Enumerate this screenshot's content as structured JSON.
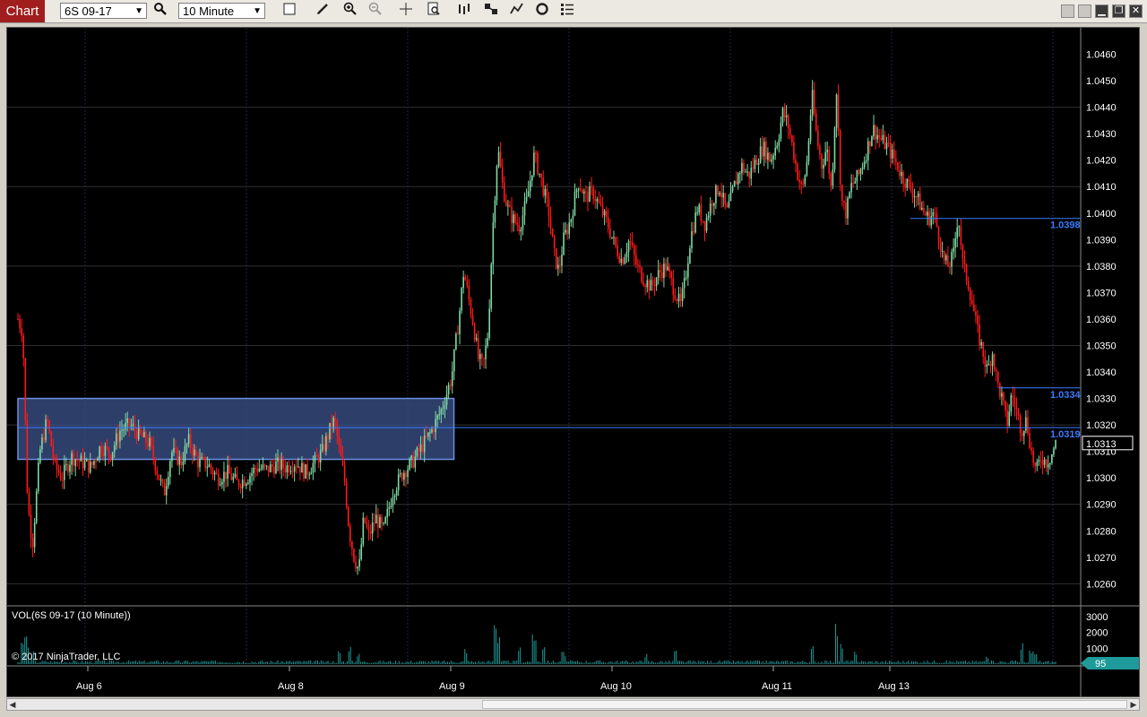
{
  "toolbar": {
    "title": "Chart",
    "instrument": "6S 09-17",
    "interval": "10 Minute"
  },
  "icons": [
    "magnifier-icon",
    "box-icon",
    "pencil-icon",
    "zoom-in-icon",
    "zoom-out-icon",
    "crosshair-icon",
    "properties-icon",
    "bars-icon",
    "tools-icon",
    "indicators-icon",
    "strategies-icon",
    "list-icon"
  ],
  "colors": {
    "up_candle": "#7fd9a3",
    "down_candle": "#ff1a1a",
    "grid": "#303030",
    "price_line": "#3a7bff",
    "rect_fill": "#3a4f86",
    "volume": "#1f9a9a"
  },
  "chart_data": {
    "type": "candlestick",
    "instrument": "6S 09-17",
    "interval": "10 Minute",
    "price_axis": [
      1.046,
      1.045,
      1.044,
      1.043,
      1.042,
      1.041,
      1.04,
      1.039,
      1.038,
      1.037,
      1.036,
      1.035,
      1.034,
      1.033,
      1.032,
      1.031,
      1.03,
      1.029,
      1.028,
      1.027,
      1.026
    ],
    "price_axis_labels": [
      "1.0460",
      "1.0450",
      "1.0440",
      "1.0430",
      "1.0420",
      "1.0410",
      "1.0400",
      "1.0390",
      "1.0380",
      "1.0370",
      "1.0360",
      "1.0350",
      "1.0340",
      "1.0330",
      "1.0320",
      "1.0310",
      "1.0300",
      "1.0290",
      "1.0280",
      "1.0270",
      "1.0260"
    ],
    "date_labels": [
      "Aug 6",
      "Aug 8",
      "Aug 9",
      "Aug 10",
      "Aug 11",
      "Aug 13"
    ],
    "current_price": 1.0313,
    "current_price_label": "1.0313",
    "horizontal_lines": [
      {
        "value": 1.0398,
        "label": "1.0398",
        "start_frac": 0.86
      },
      {
        "value": 1.0334,
        "label": "1.0334",
        "start_frac": 0.945
      },
      {
        "value": 1.0319,
        "label": "1.0319",
        "start_frac": 0.0
      }
    ],
    "zone": {
      "top": 1.033,
      "bottom": 1.0307
    },
    "path": [
      [
        0.0,
        1.036
      ],
      [
        0.01,
        1.0355
      ],
      [
        0.02,
        1.029
      ],
      [
        0.03,
        1.0275
      ],
      [
        0.045,
        1.031
      ],
      [
        0.06,
        1.0322
      ],
      [
        0.075,
        1.0305
      ],
      [
        0.09,
        1.03
      ],
      [
        0.11,
        1.0308
      ],
      [
        0.13,
        1.0306
      ],
      [
        0.15,
        1.0304
      ],
      [
        0.17,
        1.0312
      ],
      [
        0.19,
        1.0309
      ],
      [
        0.21,
        1.0318
      ],
      [
        0.23,
        1.032
      ],
      [
        0.25,
        1.0316
      ],
      [
        0.27,
        1.0313
      ],
      [
        0.29,
        1.03
      ],
      [
        0.3,
        1.0294
      ],
      [
        0.315,
        1.031
      ],
      [
        0.335,
        1.0306
      ],
      [
        0.35,
        1.0314
      ],
      [
        0.37,
        1.0306
      ],
      [
        0.39,
        1.0305
      ],
      [
        0.41,
        1.03
      ],
      [
        0.43,
        1.0302
      ],
      [
        0.45,
        1.0298
      ],
      [
        0.47,
        1.03
      ],
      [
        0.49,
        1.0304
      ],
      [
        0.51,
        1.0303
      ],
      [
        0.53,
        1.0305
      ],
      [
        0.55,
        1.0304
      ],
      [
        0.57,
        1.0306
      ],
      [
        0.59,
        1.0302
      ],
      [
        0.61,
        1.0306
      ],
      [
        0.625,
        1.031
      ],
      [
        0.64,
        1.0318
      ],
      [
        0.65,
        1.0322
      ],
      [
        0.66,
        1.031
      ],
      [
        0.67,
        1.03
      ],
      [
        0.68,
        1.028
      ],
      [
        0.69,
        1.027
      ],
      [
        0.7,
        1.0265
      ],
      [
        0.71,
        1.0285
      ],
      [
        0.72,
        1.0278
      ],
      [
        0.735,
        1.0285
      ],
      [
        0.75,
        1.028
      ],
      [
        0.77,
        1.0295
      ],
      [
        0.79,
        1.0302
      ],
      [
        0.81,
        1.0306
      ],
      [
        0.83,
        1.0312
      ],
      [
        0.85,
        1.0318
      ],
      [
        0.87,
        1.0326
      ],
      [
        0.89,
        1.0338
      ],
      [
        0.905,
        1.036
      ],
      [
        0.915,
        1.0378
      ],
      [
        0.925,
        1.0368
      ],
      [
        0.935,
        1.0358
      ],
      [
        0.945,
        1.0345
      ],
      [
        0.955,
        1.0342
      ],
      [
        0.965,
        1.0355
      ],
      [
        0.975,
        1.0395
      ],
      [
        0.985,
        1.0425
      ],
      [
        0.995,
        1.041
      ],
      [
        1.005,
        1.0402
      ],
      [
        1.015,
        1.0398
      ],
      [
        1.03,
        1.0395
      ],
      [
        1.045,
        1.0405
      ],
      [
        1.06,
        1.0422
      ],
      [
        1.075,
        1.0412
      ],
      [
        1.09,
        1.04
      ],
      [
        1.1,
        1.0385
      ],
      [
        1.11,
        1.0378
      ],
      [
        1.12,
        1.039
      ],
      [
        1.135,
        1.0398
      ],
      [
        1.15,
        1.0412
      ],
      [
        1.165,
        1.0406
      ],
      [
        1.18,
        1.0408
      ],
      [
        1.195,
        1.0402
      ],
      [
        1.21,
        1.0396
      ],
      [
        1.225,
        1.0388
      ],
      [
        1.24,
        1.0382
      ],
      [
        1.255,
        1.039
      ],
      [
        1.27,
        1.038
      ],
      [
        1.285,
        1.0375
      ],
      [
        1.3,
        1.0372
      ],
      [
        1.315,
        1.0377
      ],
      [
        1.33,
        1.038
      ],
      [
        1.345,
        1.0372
      ],
      [
        1.36,
        1.0365
      ],
      [
        1.37,
        1.0375
      ],
      [
        1.38,
        1.039
      ],
      [
        1.395,
        1.0402
      ],
      [
        1.41,
        1.0396
      ],
      [
        1.425,
        1.0405
      ],
      [
        1.44,
        1.041
      ],
      [
        1.455,
        1.04
      ],
      [
        1.47,
        1.041
      ],
      [
        1.485,
        1.0418
      ],
      [
        1.5,
        1.0414
      ],
      [
        1.515,
        1.042
      ],
      [
        1.53,
        1.0425
      ],
      [
        1.545,
        1.042
      ],
      [
        1.56,
        1.0428
      ],
      [
        1.57,
        1.0438
      ],
      [
        1.58,
        1.0434
      ],
      [
        1.59,
        1.0425
      ],
      [
        1.6,
        1.0415
      ],
      [
        1.61,
        1.0408
      ],
      [
        1.62,
        1.042
      ],
      [
        1.63,
        1.0445
      ],
      [
        1.64,
        1.0428
      ],
      [
        1.65,
        1.0418
      ],
      [
        1.66,
        1.0425
      ],
      [
        1.67,
        1.0408
      ],
      [
        1.68,
        1.0448
      ],
      [
        1.69,
        1.0405
      ],
      [
        1.7,
        1.04
      ],
      [
        1.71,
        1.041
      ],
      [
        1.725,
        1.0414
      ],
      [
        1.74,
        1.0422
      ],
      [
        1.755,
        1.0432
      ],
      [
        1.77,
        1.0428
      ],
      [
        1.785,
        1.0425
      ],
      [
        1.8,
        1.042
      ],
      [
        1.815,
        1.0414
      ],
      [
        1.83,
        1.041
      ],
      [
        1.845,
        1.0406
      ],
      [
        1.86,
        1.04
      ],
      [
        1.87,
        1.0398
      ],
      [
        1.88,
        1.04
      ],
      [
        1.89,
        1.0392
      ],
      [
        1.9,
        1.0382
      ],
      [
        1.91,
        1.038
      ],
      [
        1.92,
        1.0384
      ],
      [
        1.93,
        1.04
      ],
      [
        1.94,
        1.038
      ],
      [
        1.95,
        1.0374
      ],
      [
        1.96,
        1.0365
      ],
      [
        1.97,
        1.0355
      ],
      [
        1.98,
        1.0348
      ],
      [
        1.99,
        1.034
      ],
      [
        2.0,
        1.0348
      ],
      [
        2.01,
        1.0336
      ],
      [
        2.02,
        1.033
      ],
      [
        2.03,
        1.032
      ],
      [
        2.04,
        1.0332
      ],
      [
        2.05,
        1.0325
      ],
      [
        2.06,
        1.0318
      ],
      [
        2.07,
        1.0322
      ],
      [
        2.08,
        1.031
      ],
      [
        2.09,
        1.0302
      ],
      [
        2.1,
        1.0308
      ],
      [
        2.11,
        1.0306
      ],
      [
        2.12,
        1.0308
      ],
      [
        2.13,
        1.0313
      ]
    ],
    "path_x_max": 2.13,
    "volume_axis": [
      3000,
      2000,
      1000
    ],
    "volume_axis_labels": [
      "3000",
      "2000",
      "1000"
    ],
    "volume_title": "VOL(6S 09-17 (10 Minute))",
    "current_volume": "95",
    "volume_spikes": [
      [
        0.01,
        1800
      ],
      [
        0.015,
        2200
      ],
      [
        0.02,
        1400
      ],
      [
        0.03,
        900
      ],
      [
        0.66,
        900
      ],
      [
        0.68,
        1300
      ],
      [
        0.7,
        700
      ],
      [
        0.92,
        1100
      ],
      [
        0.98,
        3000
      ],
      [
        0.985,
        1800
      ],
      [
        1.03,
        1200
      ],
      [
        1.06,
        1900
      ],
      [
        1.08,
        1300
      ],
      [
        1.12,
        800
      ],
      [
        1.29,
        700
      ],
      [
        1.35,
        900
      ],
      [
        1.63,
        1200
      ],
      [
        1.68,
        2600
      ],
      [
        1.69,
        1600
      ],
      [
        1.72,
        900
      ],
      [
        1.99,
        600
      ],
      [
        2.06,
        1400
      ],
      [
        2.08,
        900
      ],
      [
        2.09,
        700
      ]
    ],
    "copyright": "© 2017 NinjaTrader, LLC"
  }
}
